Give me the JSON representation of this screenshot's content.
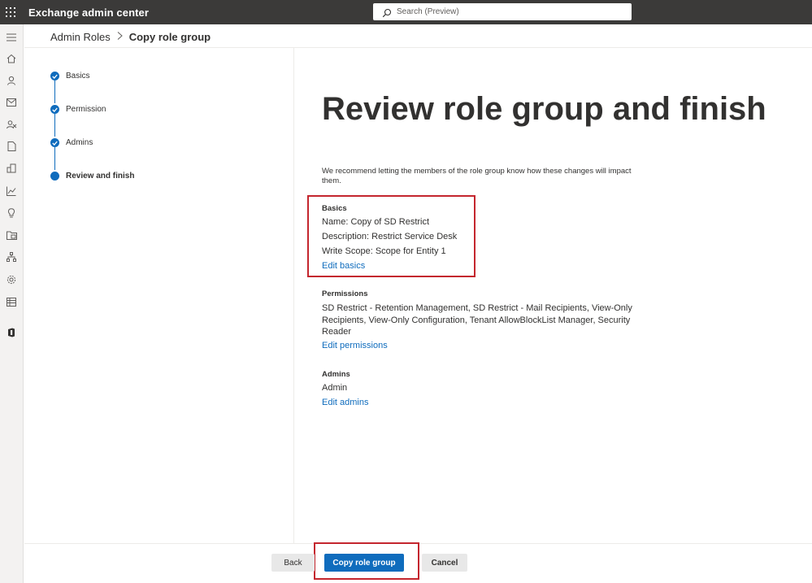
{
  "app": {
    "title": "Exchange admin center"
  },
  "search": {
    "placeholder": "Search (Preview)"
  },
  "breadcrumb": {
    "parent": "Admin Roles",
    "current": "Copy role group"
  },
  "steps": [
    {
      "label": "Basics",
      "state": "done"
    },
    {
      "label": "Permission",
      "state": "done"
    },
    {
      "label": "Admins",
      "state": "done"
    },
    {
      "label": "Review and finish",
      "state": "current"
    }
  ],
  "main": {
    "title": "Review role group and finish",
    "intro": "We recommend letting the members of the role group know how these changes will impact them.",
    "basics": {
      "heading": "Basics",
      "name": "Name: Copy of SD Restrict",
      "description": "Description: Restrict Service Desk",
      "write_scope": "Write Scope: Scope for Entity 1",
      "edit_link": "Edit basics"
    },
    "permissions": {
      "heading": "Permissions",
      "text": "SD Restrict - Retention Management, SD Restrict - Mail Recipients, View-Only Recipients, View-Only Configuration, Tenant AllowBlockList Manager, Security Reader",
      "edit_link": "Edit permissions"
    },
    "admins": {
      "heading": "Admins",
      "value": "Admin",
      "edit_link": "Edit admins"
    }
  },
  "footer": {
    "back": "Back",
    "primary": "Copy role group",
    "cancel": "Cancel"
  },
  "colors": {
    "accent": "#0f6cbd",
    "topbar": "#3b3a39",
    "highlight": "#c4262e"
  },
  "nav_icons": [
    "hamburger-icon",
    "home-icon",
    "person-icon",
    "mail-icon",
    "people-icon",
    "document-icon",
    "building-icon",
    "chart-icon",
    "lightbulb-icon",
    "folder-icon",
    "org-icon",
    "gear-icon",
    "table-icon",
    "office-icon"
  ]
}
